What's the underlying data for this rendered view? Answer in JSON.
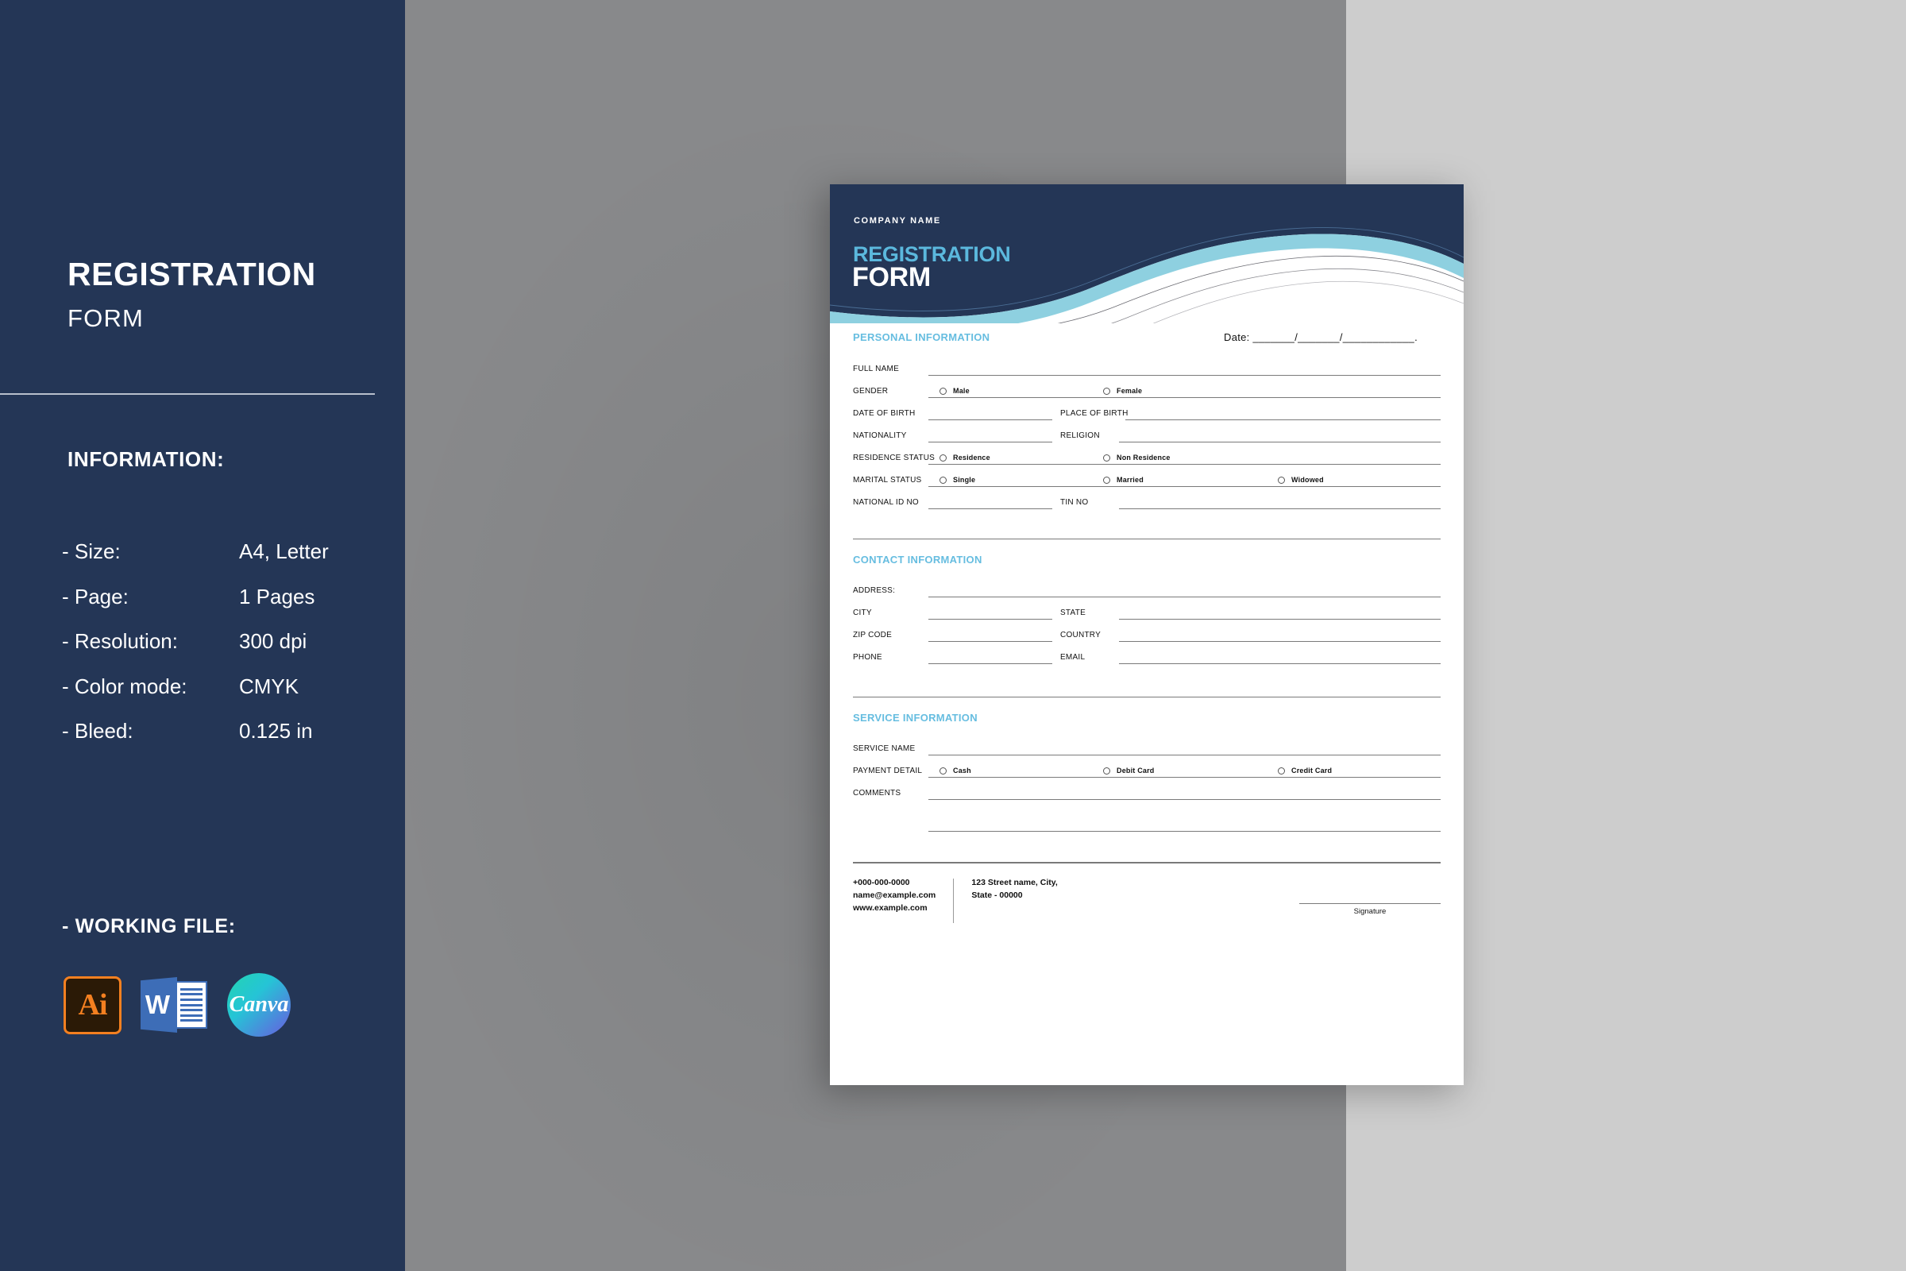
{
  "sidebar": {
    "title": "REGISTRATION",
    "subtitle": "FORM",
    "info_heading": "INFORMATION:",
    "info_rows": [
      {
        "key": "- Size:",
        "value": "A4, Letter"
      },
      {
        "key": "- Page:",
        "value": "1 Pages"
      },
      {
        "key": "- Resolution:",
        "value": "300 dpi"
      },
      {
        "key": "- Color mode:",
        "value": "CMYK"
      },
      {
        "key": "- Bleed:",
        "value": "0.125 in"
      }
    ],
    "working_file_heading": "- WORKING FILE:",
    "apps": [
      {
        "name": "adobe-illustrator-icon",
        "label": "Ai"
      },
      {
        "name": "microsoft-word-icon",
        "label": "W"
      },
      {
        "name": "canva-icon",
        "label": "Canva"
      }
    ]
  },
  "document": {
    "company_name": "COMPANY NAME",
    "title_top": "REGISTRATION",
    "title_bottom": "FORM",
    "date_label": "Date: _______/_______/____________.",
    "personal": {
      "heading": "PERSONAL INFORMATION",
      "full_name_label": "FULL NAME",
      "gender_label": "GENDER",
      "gender_options": [
        "Male",
        "Female"
      ],
      "dob_label": "DATE OF BIRTH",
      "pob_label": "PLACE OF BIRTH",
      "nationality_label": "NATIONALITY",
      "religion_label": "RELIGION",
      "residence_label": "RESIDENCE STATUS",
      "residence_options": [
        "Residence",
        "Non Residence"
      ],
      "marital_label": "MARITAL STATUS",
      "marital_options": [
        "Single",
        "Married",
        "Widowed"
      ],
      "national_id_label": "NATIONAL ID NO",
      "tin_label": "TIN NO"
    },
    "contact": {
      "heading": "CONTACT INFORMATION",
      "address_label": "ADDRESS:",
      "city_label": "CITY",
      "state_label": "STATE",
      "zip_label": "ZIP CODE",
      "country_label": "COUNTRY",
      "phone_label": "PHONE",
      "email_label": "EMAIL"
    },
    "service": {
      "heading": "SERVICE INFORMATION",
      "service_name_label": "SERVICE NAME",
      "payment_label": "PAYMENT DETAIL",
      "payment_options": [
        "Cash",
        "Debit Card",
        "Credit Card"
      ],
      "comments_label": "COMMENTS"
    },
    "footer": {
      "phone": "+000-000-0000",
      "email": "name@example.com",
      "website": "www.example.com",
      "address_line1": "123 Street name, City,",
      "address_line2": "State - 00000",
      "signature_label": "Signature"
    }
  },
  "colors": {
    "navy": "#243656",
    "accent_blue": "#5bb8dd",
    "section_blue": "#66bde0",
    "panel_gray": "#88898b",
    "page_gray": "#cdcdcd"
  }
}
